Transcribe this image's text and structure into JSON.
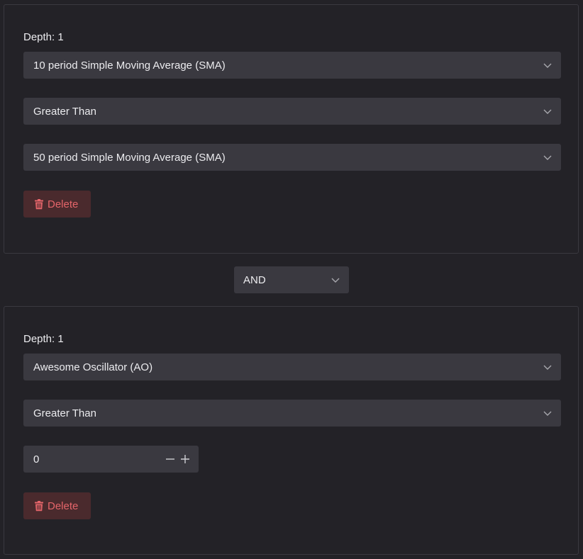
{
  "conditions": [
    {
      "depth_label": "Depth: 1",
      "left": "10 period Simple Moving Average (SMA)",
      "operator": "Greater Than",
      "right": "50 period Simple Moving Average (SMA)",
      "delete_label": "Delete"
    },
    {
      "depth_label": "Depth: 1",
      "left": "Awesome Oscillator (AO)",
      "operator": "Greater Than",
      "right_value": "0",
      "delete_label": "Delete"
    }
  ],
  "logic_operator": "AND",
  "colors": {
    "background": "#232227",
    "field": "#3a3940",
    "delete_bg": "#4a2a2d",
    "delete_text": "#e5656a"
  },
  "icons": {
    "dropdown": "chevron-down-icon",
    "delete": "trash-icon",
    "decrement": "minus-icon",
    "increment": "plus-icon"
  }
}
